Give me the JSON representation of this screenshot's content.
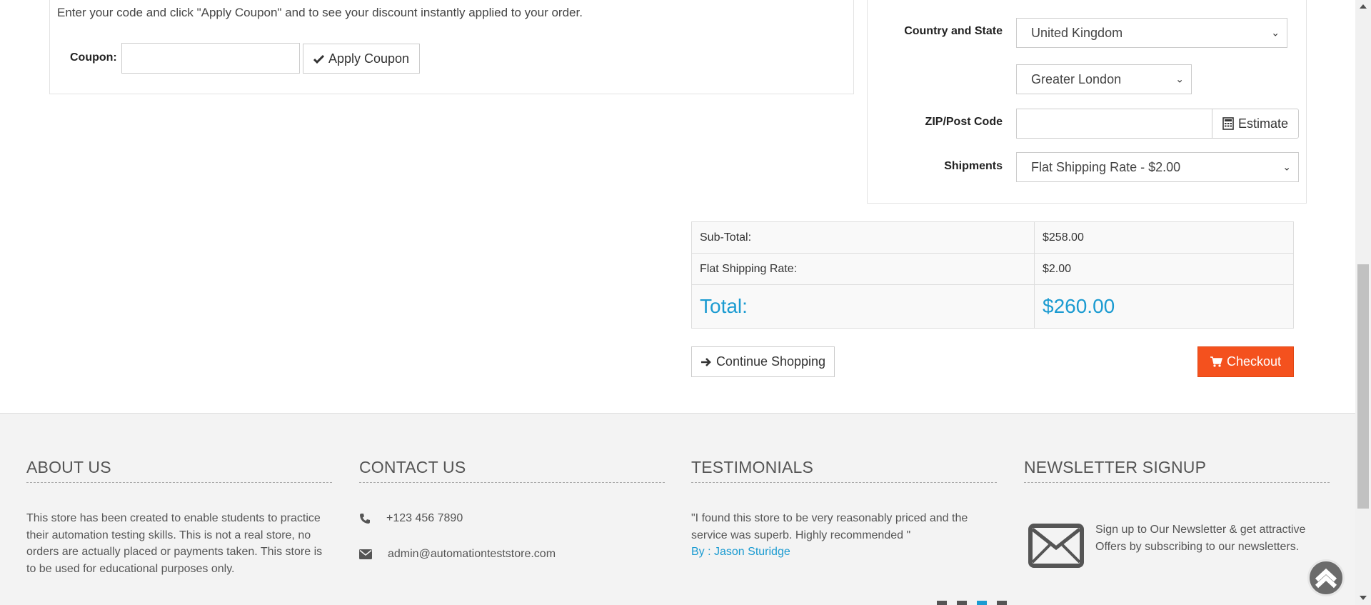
{
  "coupon": {
    "instructions": "Enter your code and click \"Apply Coupon\" and to see your discount instantly applied to your order.",
    "label": "Coupon:",
    "input_value": "",
    "apply_label": "Apply Coupon"
  },
  "estimate": {
    "country_state_label": "Country and State",
    "country_value": "United Kingdom",
    "state_value": "Greater London",
    "zip_label": "ZIP/Post Code",
    "zip_value": "",
    "estimate_label": "Estimate",
    "shipments_label": "Shipments",
    "shipments_value": "Flat Shipping Rate - $2.00"
  },
  "totals": {
    "rows": [
      {
        "label": "Sub-Total:",
        "value": "$258.00"
      },
      {
        "label": "Flat Shipping Rate:",
        "value": "$2.00"
      },
      {
        "label": "Total:",
        "value": "$260.00"
      }
    ]
  },
  "actions": {
    "continue_label": "Continue Shopping",
    "checkout_label": "Checkout"
  },
  "footer": {
    "about": {
      "title": "ABOUT US",
      "text": "This store has been created to enable students to practice their automation testing skills. This is not a real store, no orders are actually placed or payments taken. This store is to be used for educational purposes only."
    },
    "contact": {
      "title": "CONTACT US",
      "phone": "+123 456 7890",
      "email": "admin@automationteststore.com"
    },
    "testimonials": {
      "title": "TESTIMONIALS",
      "quote": "\"I found this store to be very reasonably priced and the service was superb. Highly recommended \"",
      "author": "By : Jason Sturidge"
    },
    "newsletter": {
      "title": "NEWSLETTER SIGNUP",
      "text": "Sign up to Our Newsletter & get attractive Offers by subscribing to our newsletters."
    }
  },
  "colors": {
    "accent": "#1b9bd1",
    "checkout": "#f4511e"
  }
}
